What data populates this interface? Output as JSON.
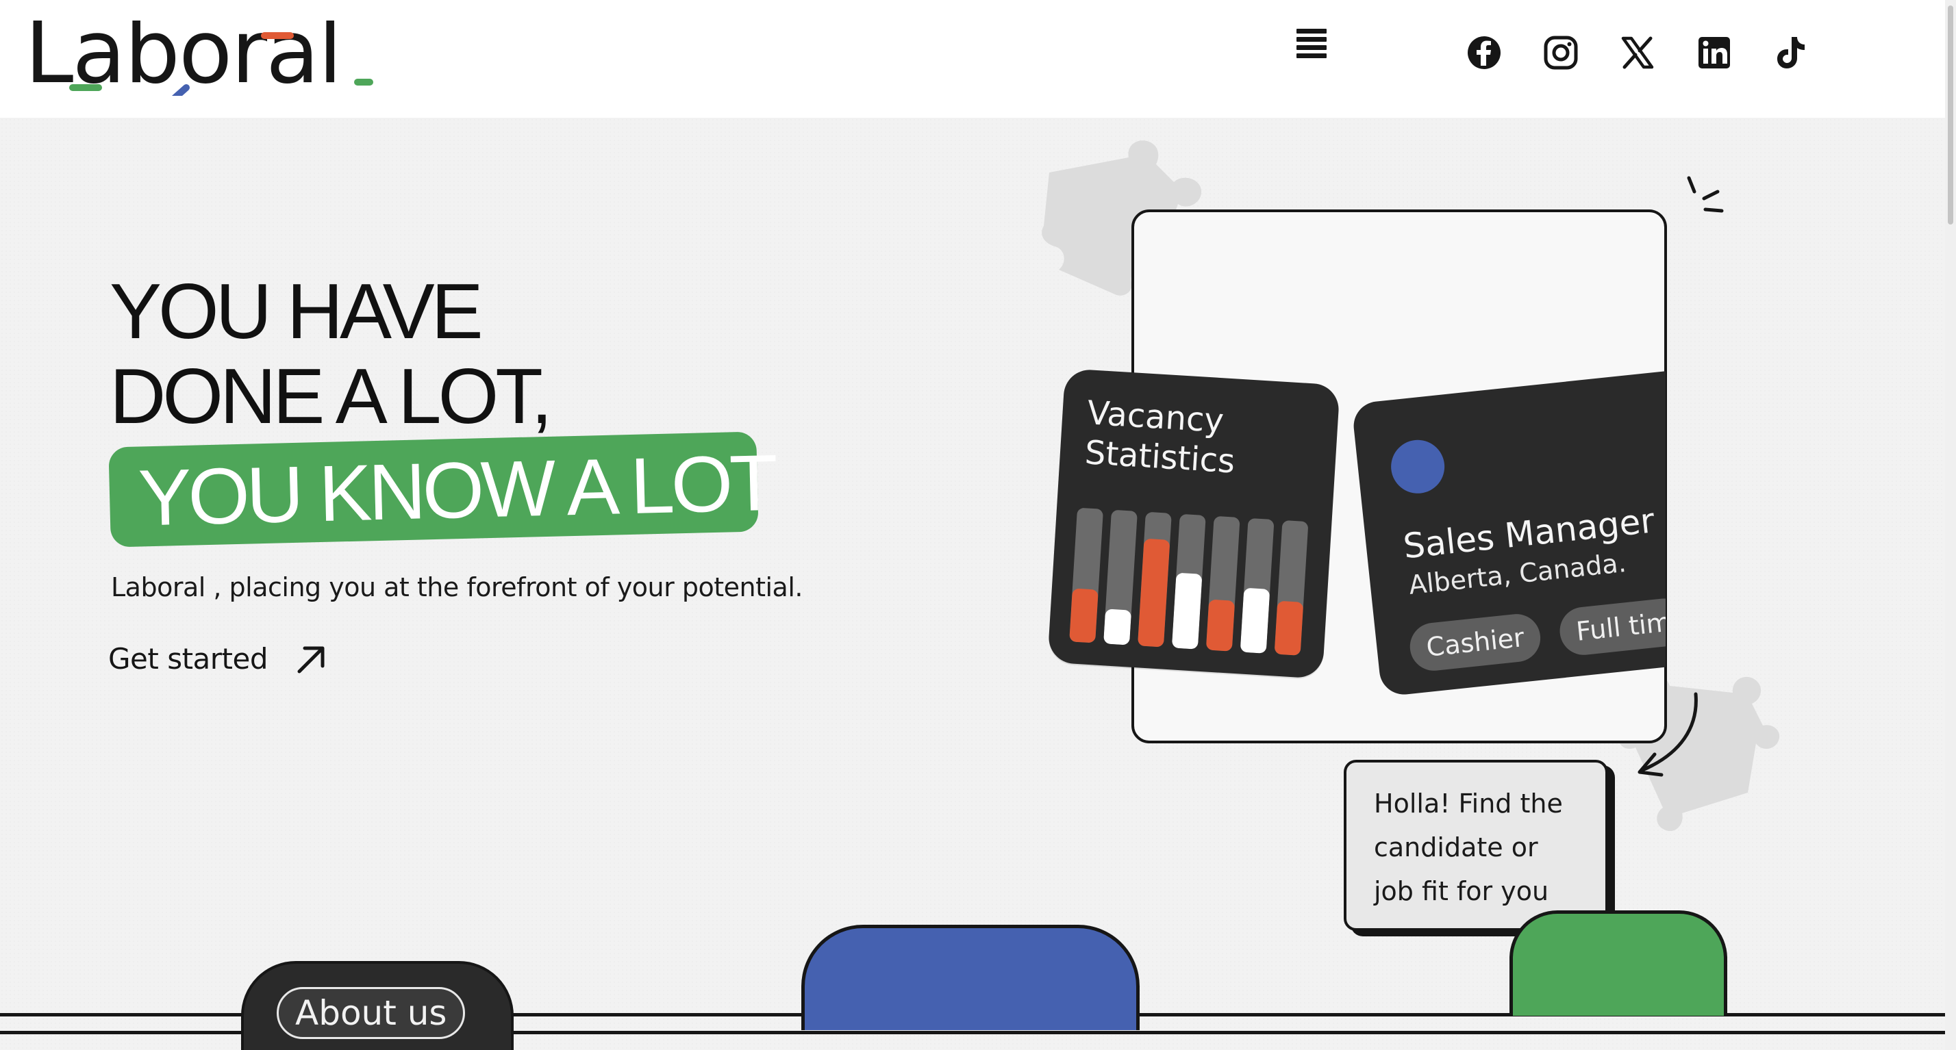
{
  "header": {
    "logo_text": "Laboral",
    "menu_icon": "hamburger-menu-icon",
    "socials": [
      "facebook-icon",
      "instagram-icon",
      "x-icon",
      "linkedin-icon",
      "tiktok-icon"
    ]
  },
  "hero": {
    "headline_line1": "YOU HAVE",
    "headline_line2": "DONE A LOT,",
    "highlight": "YOU KNOW A LOT",
    "tagline": "Laboral , placing you at the forefront of your potential.",
    "cta_label": "Get started"
  },
  "illustration": {
    "vacancy_title_line1": "Vacancy",
    "vacancy_title_line2": "Statistics",
    "bars": [
      {
        "level": 0.4,
        "color": "#e05a35"
      },
      {
        "level": 0.26,
        "color": "#ffffff"
      },
      {
        "level": 0.8,
        "color": "#e05a35"
      },
      {
        "level": 0.56,
        "color": "#ffffff"
      },
      {
        "level": 0.38,
        "color": "#e05a35"
      },
      {
        "level": 0.48,
        "color": "#ffffff"
      },
      {
        "level": 0.4,
        "color": "#e05a35"
      }
    ],
    "job_title": "Sales Manager",
    "job_location": "Alberta, Canada.",
    "chip_1": "Cashier",
    "chip_2": "Full tim",
    "bubble_line1": "Holla! Find the",
    "bubble_line2": "candidate or",
    "bubble_line3": "job fit for you"
  },
  "tabs": {
    "about_label": "About us"
  },
  "colors": {
    "green": "#4ea659",
    "blue": "#4561b0",
    "orange": "#e05a35",
    "dark": "#2a2a2a"
  }
}
